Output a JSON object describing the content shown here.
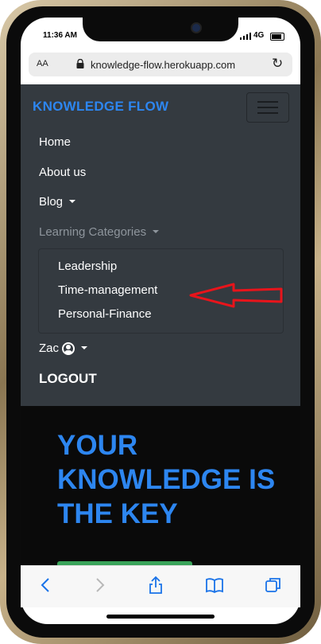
{
  "status_bar": {
    "time": "11:36 AM",
    "network": "4G"
  },
  "browser": {
    "text_size_label": "AA",
    "url": "knowledge-flow.herokuapp.com"
  },
  "nav": {
    "brand": "KNOWLEDGE FLOW",
    "items": {
      "home": "Home",
      "about": "About us",
      "blog": "Blog",
      "learning_categories": "Learning Categories"
    },
    "dropdown_items": [
      "Leadership",
      "Time-management",
      "Personal-Finance"
    ],
    "user_name": "Zac",
    "logout": "LOGOUT"
  },
  "hero": {
    "title": "YOUR KNOWLEDGE IS THE KEY"
  },
  "colors": {
    "brand": "#2d86f0",
    "navbar_bg": "#343a40",
    "annotation_arrow": "#e8141b",
    "hero_button": "#3aa35a"
  }
}
